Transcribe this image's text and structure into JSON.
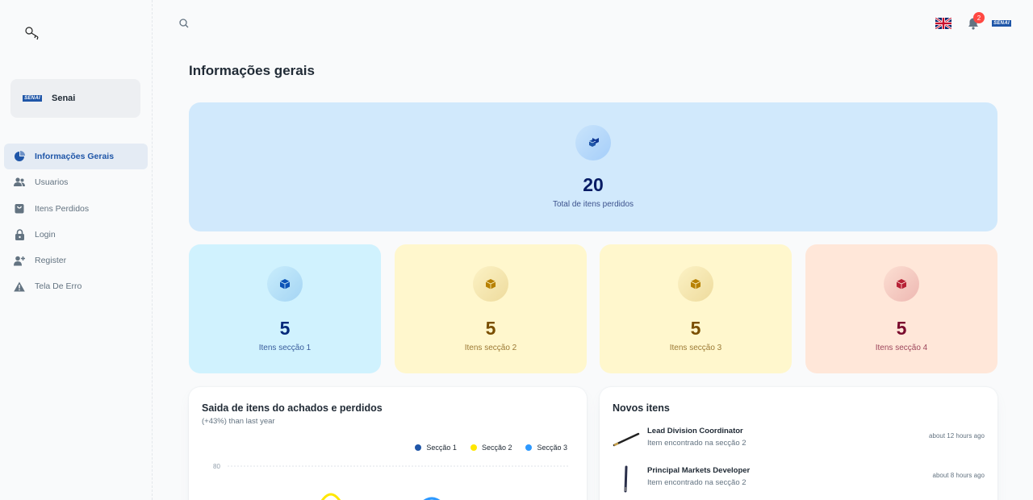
{
  "app": {
    "logo_icon": "key-logo-icon"
  },
  "account": {
    "brand": "SENAI",
    "name": "Senai"
  },
  "nav": {
    "items": [
      {
        "label": "Informações Gerais",
        "icon": "pie-chart-icon",
        "active": true
      },
      {
        "label": "Usuarios",
        "icon": "people-icon",
        "active": false
      },
      {
        "label": "Itens Perdidos",
        "icon": "shopping-bag-icon",
        "active": false
      },
      {
        "label": "Login",
        "icon": "lock-icon",
        "active": false
      },
      {
        "label": "Register",
        "icon": "person-add-icon",
        "active": false
      },
      {
        "label": "Tela De Erro",
        "icon": "alert-triangle-icon",
        "active": false
      }
    ]
  },
  "header": {
    "notifications_count": "2",
    "language_flag": "uk-flag-icon",
    "brand": "SENAI"
  },
  "page": {
    "title": "Informações gerais"
  },
  "summary": {
    "total_value": "20",
    "total_label": "Total de itens perdidos"
  },
  "sections": [
    {
      "value": "5",
      "label": "Itens secção 1"
    },
    {
      "value": "5",
      "label": "Itens secção 2"
    },
    {
      "value": "5",
      "label": "Itens secção 3"
    },
    {
      "value": "5",
      "label": "Itens secção 4"
    }
  ],
  "chart_panel": {
    "title": "Saida de itens do achados e perdidos",
    "subtitle": "(+43%) than last year"
  },
  "chart_data": {
    "type": "line",
    "y_tick_labels": [
      "80"
    ],
    "series": [
      {
        "name": "Secção 1",
        "color": "#1f56a8"
      },
      {
        "name": "Secção 2",
        "color": "#ffe700"
      },
      {
        "name": "Secção 3",
        "color": "#2d99ff"
      }
    ],
    "legend_position": "top-right",
    "grid": true
  },
  "news_panel": {
    "title": "Novos itens",
    "items": [
      {
        "title": "Lead Division Coordinator",
        "description": "Item encontrado na secção 2",
        "time": "about 12 hours ago",
        "thumb": "pen-thumbnail"
      },
      {
        "title": "Principal Markets Developer",
        "description": "Item encontrado na secção 2",
        "time": "about 8 hours ago",
        "thumb": "pen-thumbnail"
      }
    ]
  },
  "colors": {
    "accent": "#1f56a8",
    "badge": "#ff4842"
  }
}
